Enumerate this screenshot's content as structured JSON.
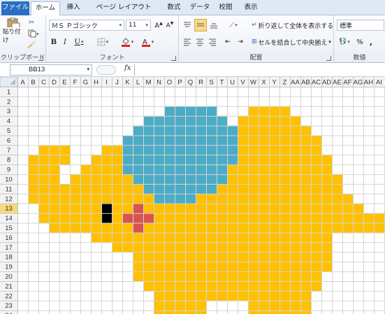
{
  "tabs": [
    {
      "label": "ファイル"
    },
    {
      "label": "ホーム"
    },
    {
      "label": "挿入"
    },
    {
      "label": "ページ レイアウト"
    },
    {
      "label": "数式"
    },
    {
      "label": "データ"
    },
    {
      "label": "校閲"
    },
    {
      "label": "表示"
    }
  ],
  "ribbon": {
    "clipboard": {
      "paste_label": "貼り付け",
      "group_label": "クリップボード"
    },
    "font": {
      "font_name": "ＭＳ Ｐゴシック",
      "font_size": "11",
      "bold": "B",
      "italic": "I",
      "underline": "U",
      "group_label": "フォント"
    },
    "alignment": {
      "wrap_label": "折り返して全体を表示する",
      "merge_label": "セルを結合して中央揃え",
      "group_label": "配置"
    },
    "number": {
      "format": "標準",
      "percent": "%",
      "comma": ",",
      "group_label": "数値"
    }
  },
  "formula_bar": {
    "name_box": "BB13",
    "fx": "fx",
    "content": ""
  },
  "sheet": {
    "columns": [
      "A",
      "B",
      "C",
      "D",
      "E",
      "F",
      "G",
      "H",
      "I",
      "J",
      "K",
      "L",
      "M",
      "N",
      "O",
      "P",
      "Q",
      "R",
      "S",
      "T",
      "U",
      "V",
      "W",
      "X",
      "Y",
      "Z",
      "AA",
      "AB",
      "AC",
      "AD",
      "AE",
      "AF",
      "AG",
      "AH",
      "AI"
    ],
    "rows": [
      "1",
      "2",
      "3",
      "4",
      "5",
      "6",
      "7",
      "8",
      "9",
      "10",
      "11",
      "12",
      "13",
      "14",
      "15",
      "16",
      "17",
      "18",
      "19",
      "20",
      "21",
      "22",
      "23",
      "24"
    ],
    "selected_row": "13",
    "colors": {
      "body": "#FFC000",
      "ear": "#4BACC6",
      "eye": "#000000",
      "cheek": "#D9534F",
      "grid": "#D4D4D4",
      "header_bg": "#F3F3F3",
      "header_selected": "#F9D879"
    }
  }
}
